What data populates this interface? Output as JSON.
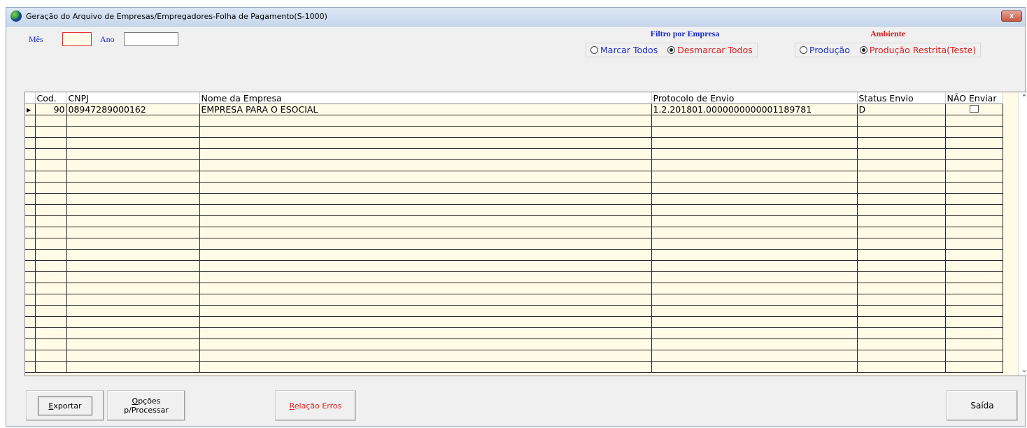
{
  "window": {
    "title": "Geração do Arquivo de Empresas/Empregadores-Folha de Pagamento(S-1000)",
    "close_label": "x"
  },
  "filters": {
    "mes_label": "Mês",
    "mes_value": "",
    "ano_label": "Ano",
    "ano_value": ""
  },
  "filtro_empresa": {
    "title": "Filtro por Empresa",
    "options": [
      {
        "label": "Marcar Todos",
        "selected": false
      },
      {
        "label": "Desmarcar Todos",
        "selected": true
      }
    ]
  },
  "ambiente": {
    "title": "Ambiente",
    "options": [
      {
        "label": "Produção",
        "selected": false
      },
      {
        "label": "Produção Restrita(Teste)",
        "selected": true
      }
    ]
  },
  "grid": {
    "columns": [
      "Cod.",
      "CNPJ",
      "Nome da Empresa",
      "Protocolo de Envio",
      "Status Envio",
      "NÃO Enviar"
    ],
    "rows": [
      {
        "cod": "90",
        "cnpj": "08947289000162",
        "nome": "EMPRESA PARA O ESOCIAL",
        "protocolo": "1.2.201801.0000000000001189781",
        "status": "D",
        "nao_enviar": false
      }
    ],
    "empty_rows": 23
  },
  "buttons": {
    "exportar": {
      "accel": "E",
      "rest": "xportar"
    },
    "opcoes_line1": {
      "accel": "O",
      "rest": "pções"
    },
    "opcoes_line2": "p/Processar",
    "relacao": {
      "accel": "R",
      "rest": "elação Erros"
    },
    "saida": "Saída"
  },
  "colors": {
    "grid_bg": "#fffbe6",
    "accent_blue": "#1a2cd0",
    "accent_red": "#e01a1a"
  }
}
